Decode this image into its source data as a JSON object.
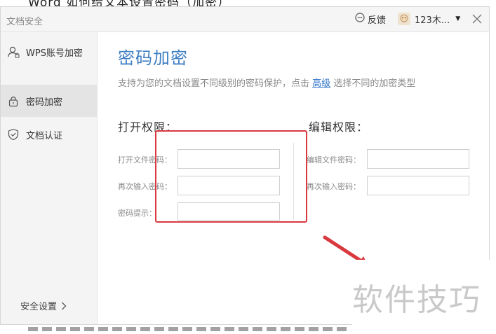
{
  "background_doc": {
    "top_text": "Word 如何给文本设置密码（加密）"
  },
  "window": {
    "title": "文档安全",
    "feedback_label": "反馈",
    "user_name": "123木..."
  },
  "sidebar": {
    "items": [
      {
        "label": "WPS账号加密",
        "icon": "user-lock-icon"
      },
      {
        "label": "密码加密",
        "icon": "padlock-icon"
      },
      {
        "label": "文档认证",
        "icon": "shield-check-icon"
      }
    ],
    "security_settings_label": "安全设置"
  },
  "main": {
    "title": "密码加密",
    "desc_before": "支持为您的文档设置不同级别的密码保护，点击",
    "desc_link": "高级",
    "desc_after": "选择不同的加密类型",
    "open_section": {
      "heading": "打开权限：",
      "fields": [
        {
          "label": "打开文件密码："
        },
        {
          "label": "再次输入密码："
        },
        {
          "label": "密码提示："
        }
      ]
    },
    "edit_section": {
      "heading": "编辑权限：",
      "fields": [
        {
          "label": "编辑文件密码："
        },
        {
          "label": "再次输入密码："
        }
      ]
    }
  },
  "annotation": {
    "box_color": "#d9393e",
    "arrow_color": "#d9393e"
  },
  "watermark": "软件技巧",
  "colors": {
    "accent": "#3d7ec2",
    "link": "#2f73c9",
    "sidebar_bg": "#f4f4f4",
    "sidebar_active": "#e4e4e4"
  }
}
